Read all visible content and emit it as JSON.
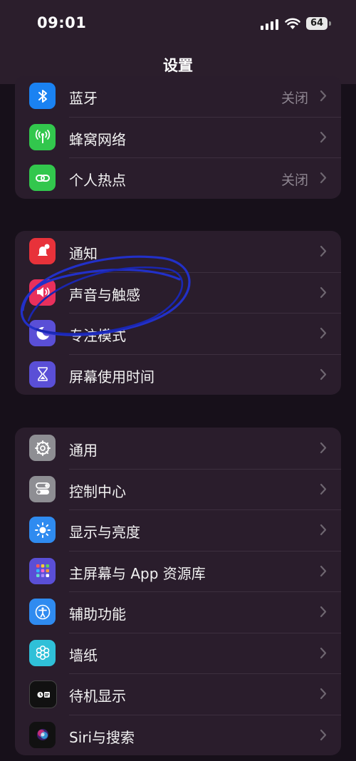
{
  "status_bar": {
    "time": "09:01",
    "battery": "64"
  },
  "nav": {
    "title": "设置"
  },
  "group1": [
    {
      "label": "蓝牙",
      "value": "关闭",
      "icon": "bluetooth-icon",
      "color": "#1a82f2"
    },
    {
      "label": "蜂窝网络",
      "value": "",
      "icon": "cellular-icon",
      "color": "#32c74d"
    },
    {
      "label": "个人热点",
      "value": "关闭",
      "icon": "hotspot-icon",
      "color": "#32c74d"
    }
  ],
  "group2": [
    {
      "label": "通知",
      "icon": "notification-icon",
      "color": "#e8323a"
    },
    {
      "label": "声音与触感",
      "icon": "sound-icon",
      "color": "#e8305c"
    },
    {
      "label": "专注模式",
      "icon": "moon-icon",
      "color": "#5a4fd6"
    },
    {
      "label": "屏幕使用时间",
      "icon": "hourglass-icon",
      "color": "#5a4fd6"
    }
  ],
  "group3": [
    {
      "label": "通用",
      "icon": "gear-icon",
      "color": "#8e8e93"
    },
    {
      "label": "控制中心",
      "icon": "toggle-icon",
      "color": "#8e8e93"
    },
    {
      "label": "显示与亮度",
      "icon": "brightness-icon",
      "color": "#2f8bf0"
    },
    {
      "label": "主屏幕与 App 资源库",
      "icon": "home-grid-icon",
      "color": "#5a4fd6"
    },
    {
      "label": "辅助功能",
      "icon": "accessibility-icon",
      "color": "#2f8bf0"
    },
    {
      "label": "墙纸",
      "icon": "flower-icon",
      "color": "#2fc0d8"
    },
    {
      "label": "待机显示",
      "icon": "standby-icon",
      "color": "#111111"
    },
    {
      "label": "Siri与搜索",
      "icon": "siri-icon",
      "color": "#111111"
    }
  ]
}
